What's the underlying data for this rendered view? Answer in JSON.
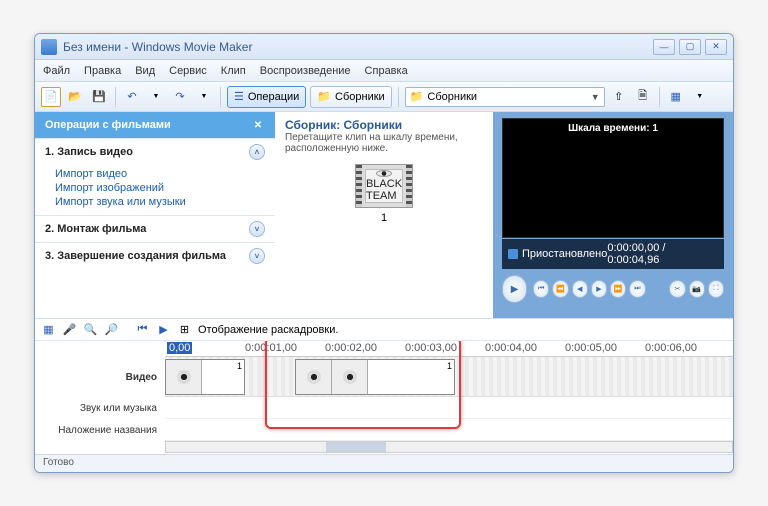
{
  "window": {
    "title": "Без имени - Windows Movie Maker"
  },
  "menu": {
    "file": "Файл",
    "edit": "Правка",
    "view": "Вид",
    "service": "Сервис",
    "clip": "Клип",
    "playback": "Воспроизведение",
    "help": "Справка"
  },
  "toolbar": {
    "operations": "Операции",
    "collections": "Сборники",
    "dropdown": "Сборники"
  },
  "tasks": {
    "header": "Операции с фильмами",
    "s1": {
      "title": "1. Запись видео",
      "l1": "Импорт видео",
      "l2": "Импорт изображений",
      "l3": "Импорт звука или музыки"
    },
    "s2": {
      "title": "2. Монтаж фильма"
    },
    "s3": {
      "title": "3. Завершение создания фильма"
    }
  },
  "collection": {
    "title": "Сборник: Сборники",
    "sub": "Перетащите клип на шкалу времени, расположенную ниже.",
    "clip_label": "1",
    "frame_text": "BLACK TEAM"
  },
  "preview": {
    "title": "Шкала времени: 1",
    "status": "Приостановлено",
    "time": "0:00:00,00 / 0:00:04,96"
  },
  "timeline": {
    "label": "Отображение раскадровки.",
    "tracks": {
      "video": "Видео",
      "audio": "Звук или музыка",
      "title": "Наложение названия"
    },
    "ticks": {
      "t0": "0,00",
      "t1": "0:00:01,00",
      "t2": "0:00:02,00",
      "t3": "0:00:03,00",
      "t4": "0:00:04,00",
      "t5": "0:00:05,00",
      "t6": "0:00:06,00"
    },
    "clip1": "1",
    "clip2": "1"
  },
  "statusbar": "Готово"
}
